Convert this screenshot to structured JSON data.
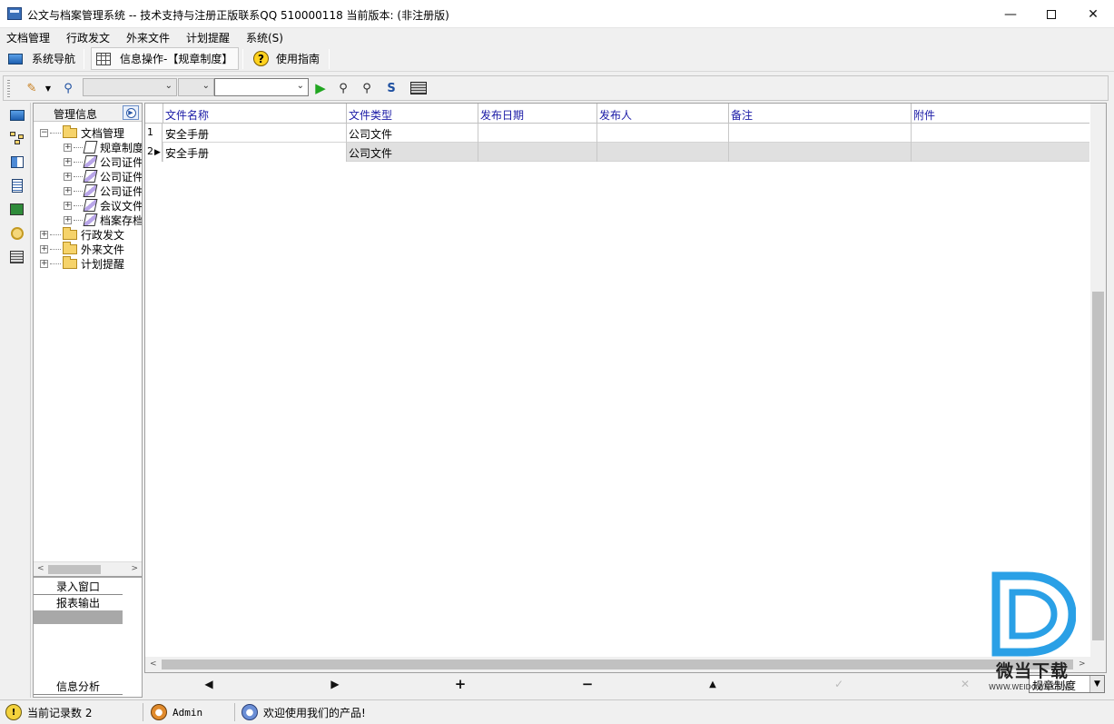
{
  "window": {
    "title": "公文与档案管理系统 -- 技术支持与注册正版联系QQ 510000118    当前版本: (非注册版)",
    "controls": [
      "minimize-icon",
      "maximize-icon",
      "close-icon"
    ]
  },
  "menu": [
    "文档管理",
    "行政发文",
    "外来文件",
    "计划提醒",
    "系统(S)"
  ],
  "nav": {
    "system_nav": "系统导航",
    "info_op": "信息操作-【规章制度】",
    "guide": "使用指南"
  },
  "tree": {
    "header": "管理信息",
    "nodes": [
      {
        "label": "文档管理",
        "expander": "⊟",
        "type": "folder"
      },
      {
        "label": "规章制度",
        "type": "leaf"
      },
      {
        "label": "公司证件",
        "type": "leaf"
      },
      {
        "label": "公司证件",
        "type": "leaf"
      },
      {
        "label": "公司证件",
        "type": "leaf"
      },
      {
        "label": "会议文件",
        "type": "leaf"
      },
      {
        "label": "档案存档",
        "type": "leaf"
      },
      {
        "label": "行政发文",
        "expander": "⊞",
        "type": "folder"
      },
      {
        "label": "外来文件",
        "expander": "⊞",
        "type": "folder"
      },
      {
        "label": "计划提醒",
        "expander": "⊞",
        "type": "folder"
      }
    ]
  },
  "side_panel": {
    "entry_window": "录入窗口",
    "report_output": "报表输出",
    "info_analysis": "信息分析"
  },
  "grid": {
    "columns": [
      "文件名称",
      "文件类型",
      "发布日期",
      "发布人",
      "备注",
      "附件"
    ],
    "rows": [
      {
        "index": "1",
        "cells": [
          "安全手册",
          "公司文件",
          "",
          "",
          "",
          ""
        ]
      },
      {
        "index": "2",
        "cells": [
          "安全手册",
          "公司文件",
          "",
          "",
          "",
          ""
        ]
      }
    ],
    "selected_row": 2
  },
  "navigator": {
    "filter_value": "规章制度"
  },
  "status": {
    "record_count": "当前记录数 2",
    "user": "Admin",
    "welcome": "欢迎使用我们的产品!"
  },
  "watermark": {
    "text": "微当下载",
    "url": "WWW.WEIDOWN.COM"
  },
  "colors": {
    "header_text": "#1a1aa6",
    "selected_row": "#e0e0e0",
    "play_green": "#21a621",
    "watermark_blue": "#2aa0e6"
  }
}
